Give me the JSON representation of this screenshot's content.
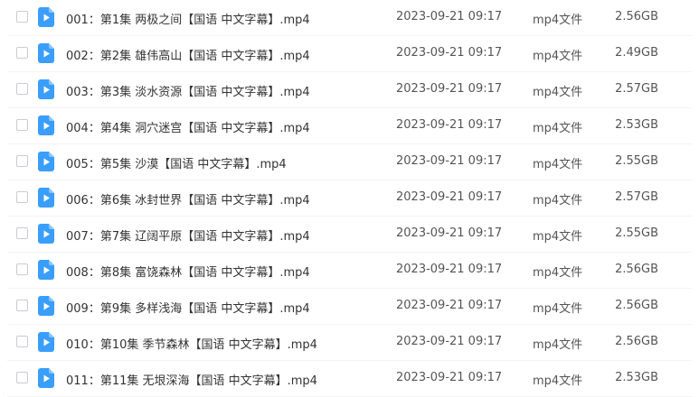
{
  "icon": "video-file-icon",
  "colors": {
    "icon": "#3a9efe",
    "text": "#333333",
    "meta": "#555555",
    "divider": "#f2f3f5"
  },
  "files": [
    {
      "name": "001：第1集 两极之间【国语 中文字幕】.mp4",
      "date": "2023-09-21 09:17",
      "type": "mp4文件",
      "size": "2.56GB"
    },
    {
      "name": "002：第2集 雄伟高山【国语 中文字幕】.mp4",
      "date": "2023-09-21 09:17",
      "type": "mp4文件",
      "size": "2.49GB"
    },
    {
      "name": "003：第3集 淡水资源【国语 中文字幕】.mp4",
      "date": "2023-09-21 09:17",
      "type": "mp4文件",
      "size": "2.57GB"
    },
    {
      "name": "004：第4集 洞穴迷宫【国语 中文字幕】.mp4",
      "date": "2023-09-21 09:17",
      "type": "mp4文件",
      "size": "2.53GB"
    },
    {
      "name": "005：第5集 沙漠【国语 中文字幕】.mp4",
      "date": "2023-09-21 09:17",
      "type": "mp4文件",
      "size": "2.55GB"
    },
    {
      "name": "006：第6集 冰封世界【国语 中文字幕】.mp4",
      "date": "2023-09-21 09:17",
      "type": "mp4文件",
      "size": "2.57GB"
    },
    {
      "name": "007：第7集 辽阔平原【国语 中文字幕】.mp4",
      "date": "2023-09-21 09:17",
      "type": "mp4文件",
      "size": "2.55GB"
    },
    {
      "name": "008：第8集 富饶森林【国语 中文字幕】.mp4",
      "date": "2023-09-21 09:17",
      "type": "mp4文件",
      "size": "2.56GB"
    },
    {
      "name": "009：第9集 多样浅海【国语 中文字幕】.mp4",
      "date": "2023-09-21 09:17",
      "type": "mp4文件",
      "size": "2.56GB"
    },
    {
      "name": "010：第10集 季节森林【国语 中文字幕】.mp4",
      "date": "2023-09-21 09:17",
      "type": "mp4文件",
      "size": "2.56GB"
    },
    {
      "name": "011：第11集 无垠深海【国语 中文字幕】.mp4",
      "date": "2023-09-21 09:17",
      "type": "mp4文件",
      "size": "2.53GB"
    }
  ]
}
